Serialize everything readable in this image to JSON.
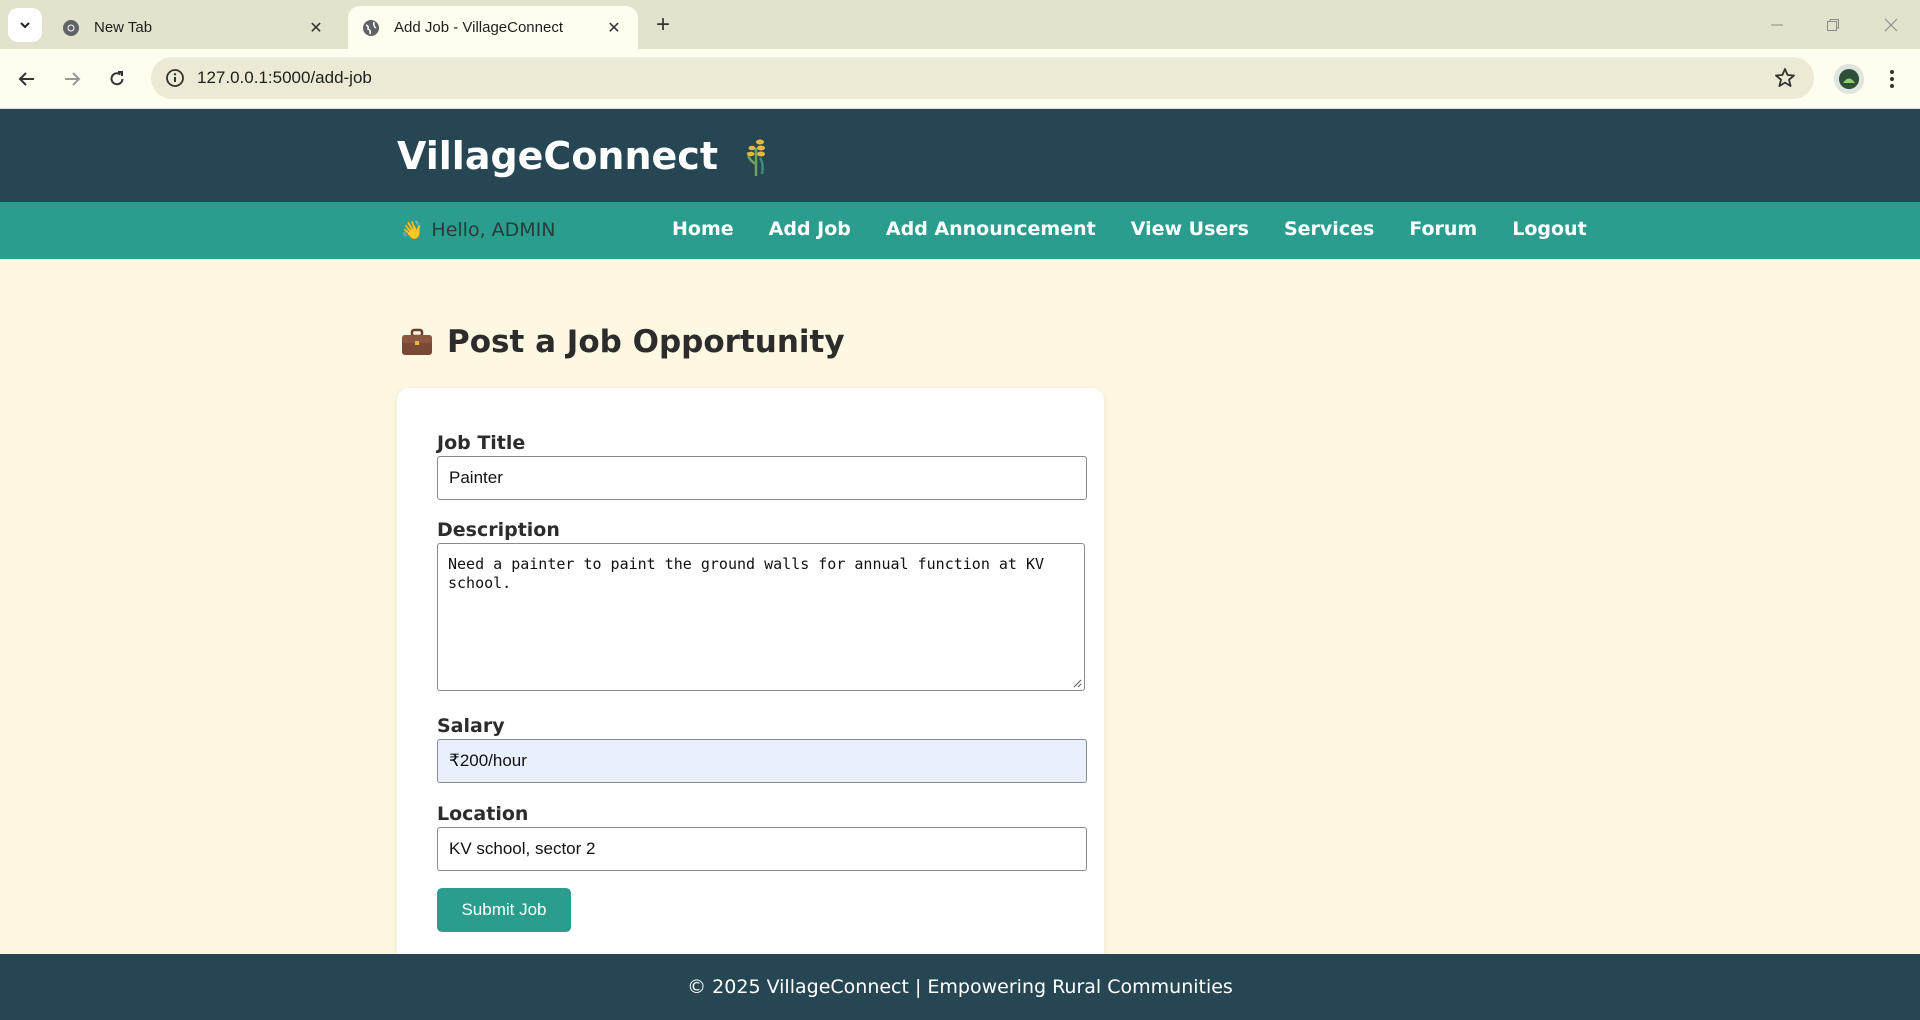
{
  "browser": {
    "tabs": [
      {
        "title": "New Tab",
        "active": false
      },
      {
        "title": "Add Job - VillageConnect",
        "active": true
      }
    ],
    "url": "127.0.0.1:5000/add-job"
  },
  "header": {
    "brand": "VillageConnect"
  },
  "nav": {
    "greeting": "Hello, ADMIN",
    "links": [
      "Home",
      "Add Job",
      "Add Announcement",
      "View Users",
      "Services",
      "Forum",
      "Logout"
    ]
  },
  "page": {
    "title": "Post a Job Opportunity"
  },
  "form": {
    "job_title_label": "Job Title",
    "job_title_value": "Painter",
    "description_label": "Description",
    "description_value": "Need a painter to paint the ground walls for annual function at KV school.",
    "salary_label": "Salary",
    "salary_value": "₹200/hour",
    "location_label": "Location",
    "location_value": "KV school, sector 2",
    "submit_label": "Submit Job"
  },
  "footer": {
    "text": "© 2025 VillageConnect | Empowering Rural Communities"
  },
  "colors": {
    "header_bg": "#264653",
    "nav_bg": "#2a9d8f",
    "page_bg": "#fdf8e1",
    "button_bg": "#2a9d8f",
    "autofill_bg": "#e8f0fe"
  }
}
